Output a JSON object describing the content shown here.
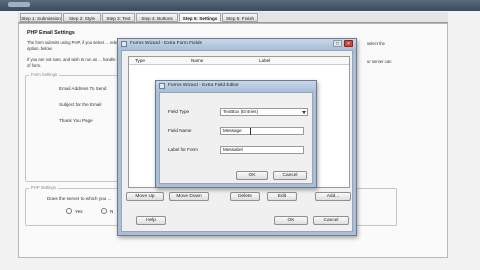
{
  "tabs": [
    "Step 1: Submission",
    "Step 2: Style",
    "Step 3: Text",
    "Step 4: Buttons",
    "Step 5: Settings",
    "Step 6: Finish"
  ],
  "main": {
    "title": "PHP Email Settings",
    "desc1": "The form submits using PHP, if you select ... relevant option, below.",
    "desc2": "If you are not sure, and wish to run as ... handle this type of form.",
    "right_text1": "select the",
    "right_text2": "ur server can",
    "form_settings_label": "Form Settings",
    "email_label": "Email Address To Send",
    "subject_label": "Subject for the Email",
    "thankyou_label": "Thank You Page",
    "php_settings_label": "PHP Settings",
    "server_question": "Does the server to which you ...",
    "yes": "Yes",
    "no": "N"
  },
  "extra_fields_dialog": {
    "title": "Forms Wizard - Extra Form Fields",
    "columns": [
      "Type",
      "Name",
      "Label"
    ],
    "move_up": "Move Up",
    "move_down": "Move Down",
    "delete": "Delete",
    "edit": "Edit",
    "add": "Add...",
    "help": "Help",
    "ok": "OK",
    "cancel": "Cancel"
  },
  "field_editor_dialog": {
    "title": "Forms Wizard - Extra Field Editor",
    "field_type_label": "Field Type",
    "field_type_value": "TextBox (Entries)",
    "field_name_label": "Field Name",
    "field_name_value": "Message",
    "label_for_form_label": "Label for Form",
    "label_for_form_value": "Messabel",
    "ok": "OK",
    "cancel": "Cancel"
  },
  "colors": {
    "title_bar": "#a9bfd8",
    "close_button": "#c44a3c"
  }
}
